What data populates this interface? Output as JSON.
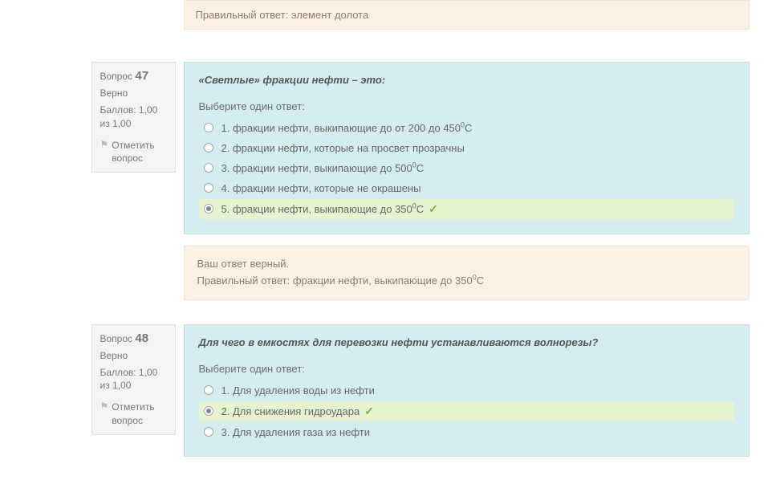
{
  "top_feedback": {
    "correct_label": "Правильный ответ: ",
    "correct_text": "элемент долота"
  },
  "q47": {
    "label": "Вопрос ",
    "number": "47",
    "status": "Верно",
    "score_label": "Баллов: ",
    "score_value": "1,00 из 1,00",
    "flag_label": "Отметить вопрос",
    "question_text": "«Светлые» фракции нефти – это:",
    "prompt": "Выберите один ответ:",
    "answers": [
      {
        "n": "1.",
        "pre": "фракции нефти, выкипающие до от 200 до 450",
        "sup": "0",
        "post": "С",
        "selected": false,
        "correct": false
      },
      {
        "n": "2.",
        "pre": "фракции нефти, которые на просвет прозрачны",
        "sup": "",
        "post": "",
        "selected": false,
        "correct": false
      },
      {
        "n": "3.",
        "pre": "фракции нефти, выкипающие до 500",
        "sup": "0",
        "post": "С",
        "selected": false,
        "correct": false
      },
      {
        "n": "4.",
        "pre": "фракции нефти, которые не окрашены",
        "sup": "",
        "post": "",
        "selected": false,
        "correct": false
      },
      {
        "n": "5.",
        "pre": "фракции нефти, выкипающие до 350",
        "sup": "0",
        "post": "С",
        "selected": true,
        "correct": true
      }
    ],
    "fb_line1": "Ваш ответ верный.",
    "fb_line2_pre": "Правильный ответ: фракции нефти, выкипающие до 350",
    "fb_line2_sup": "0",
    "fb_line2_post": "С"
  },
  "q48": {
    "label": "Вопрос ",
    "number": "48",
    "status": "Верно",
    "score_label": "Баллов: ",
    "score_value": "1,00 из 1,00",
    "flag_label": "Отметить вопрос",
    "question_text": "Для чего в емкостях для перевозки нефти устанавливаются волнорезы?",
    "prompt": "Выберите один ответ:",
    "answers": [
      {
        "n": "1.",
        "pre": "Для удаления воды из нефти",
        "sup": "",
        "post": "",
        "selected": false,
        "correct": false
      },
      {
        "n": "2.",
        "pre": "Для снижения гидроудара",
        "sup": "",
        "post": "",
        "selected": true,
        "correct": true
      },
      {
        "n": "3.",
        "pre": "Для удаления газа из нефти",
        "sup": "",
        "post": "",
        "selected": false,
        "correct": false
      }
    ]
  },
  "checkmark": "✓"
}
